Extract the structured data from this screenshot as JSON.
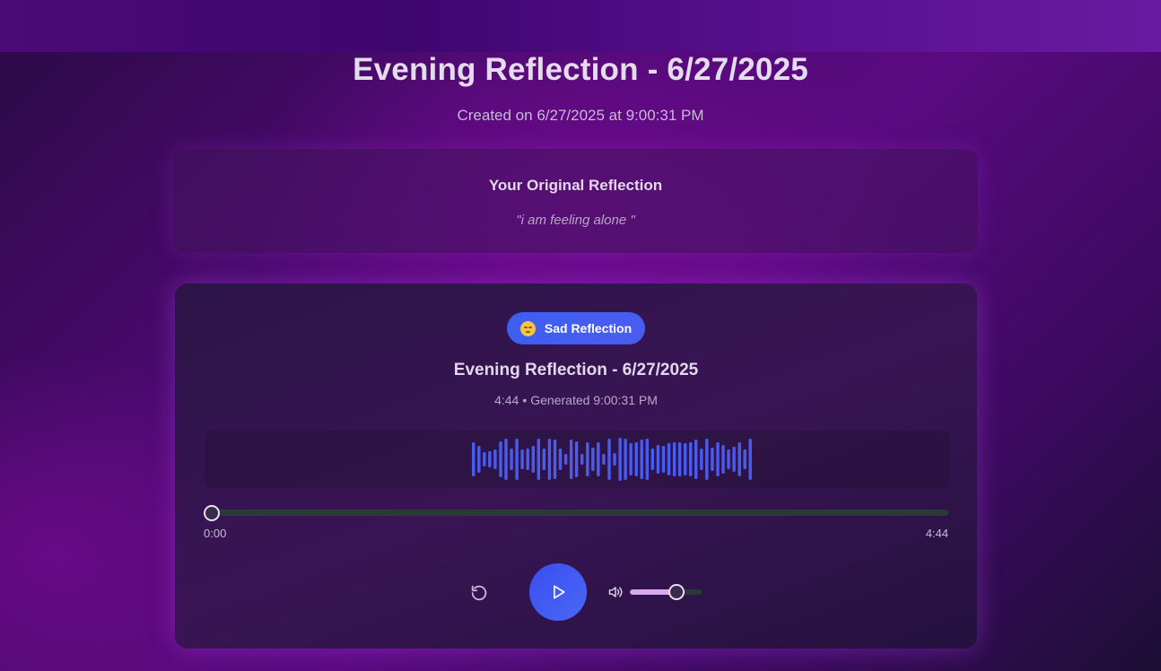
{
  "header": {
    "page_title": "Evening Reflection - 6/27/2025",
    "created": "Created on 6/27/2025 at 9:00:31 PM"
  },
  "original": {
    "title": "Your Original Reflection",
    "text": "\"i am feeling alone \""
  },
  "player": {
    "badge_emoji": "sad-face-icon",
    "badge_label": "Sad Reflection",
    "track_title": "Evening Reflection - 6/27/2025",
    "duration": "4:44",
    "separator": "•",
    "generated": "Generated 9:00:31 PM",
    "current_time": "0:00",
    "total_time": "4:44",
    "progress": 0,
    "volume": 0.65,
    "accent_color": "#3d5ff0",
    "volume_color": "#d9a6f0",
    "icons": {
      "restart": "restart-icon",
      "play": "play-icon",
      "volume": "volume-icon"
    }
  }
}
